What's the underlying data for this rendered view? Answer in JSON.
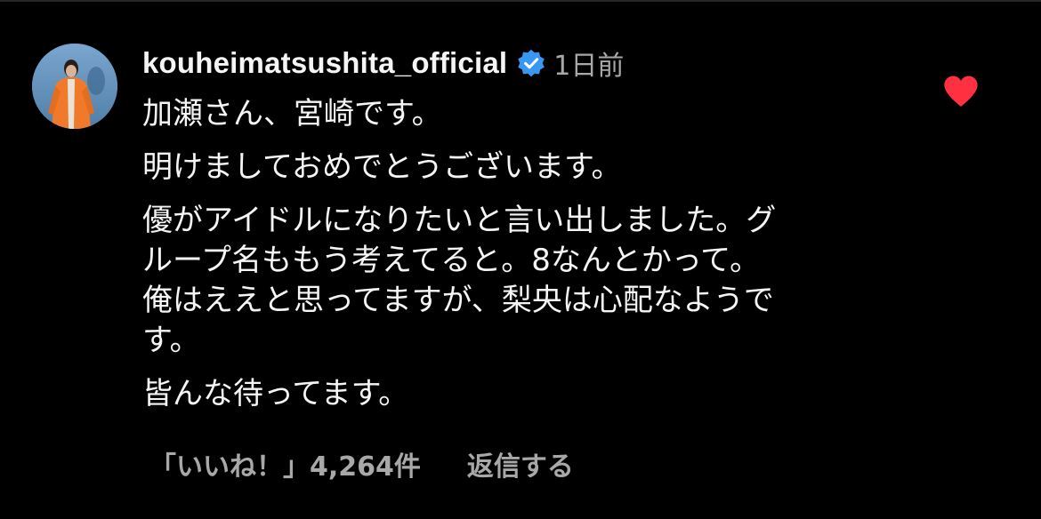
{
  "comment": {
    "username": "kouheimatsushita_official",
    "verified_icon": "verified-badge-icon",
    "time_ago": "1日前",
    "liked_icon": "heart-filled-icon",
    "colors": {
      "background": "#000000",
      "text": "#f5f5f5",
      "secondary_text": "#a8a8a8",
      "verified_badge": "#3897f0",
      "heart": "#ff3040"
    },
    "lines": [
      "加瀬さん、宮崎です。",
      "明けましておめでとうございます。",
      "優がアイドルになりたいと言い出しました。グ",
      "ループ名ももう考えてると。8なんとかって。",
      "俺はええと思ってますが、梨央は心配なようで",
      "す。",
      "皆んな待ってます。"
    ]
  },
  "footer": {
    "likes_label": "「いいね！」4,264件",
    "reply_label": "返信する"
  }
}
